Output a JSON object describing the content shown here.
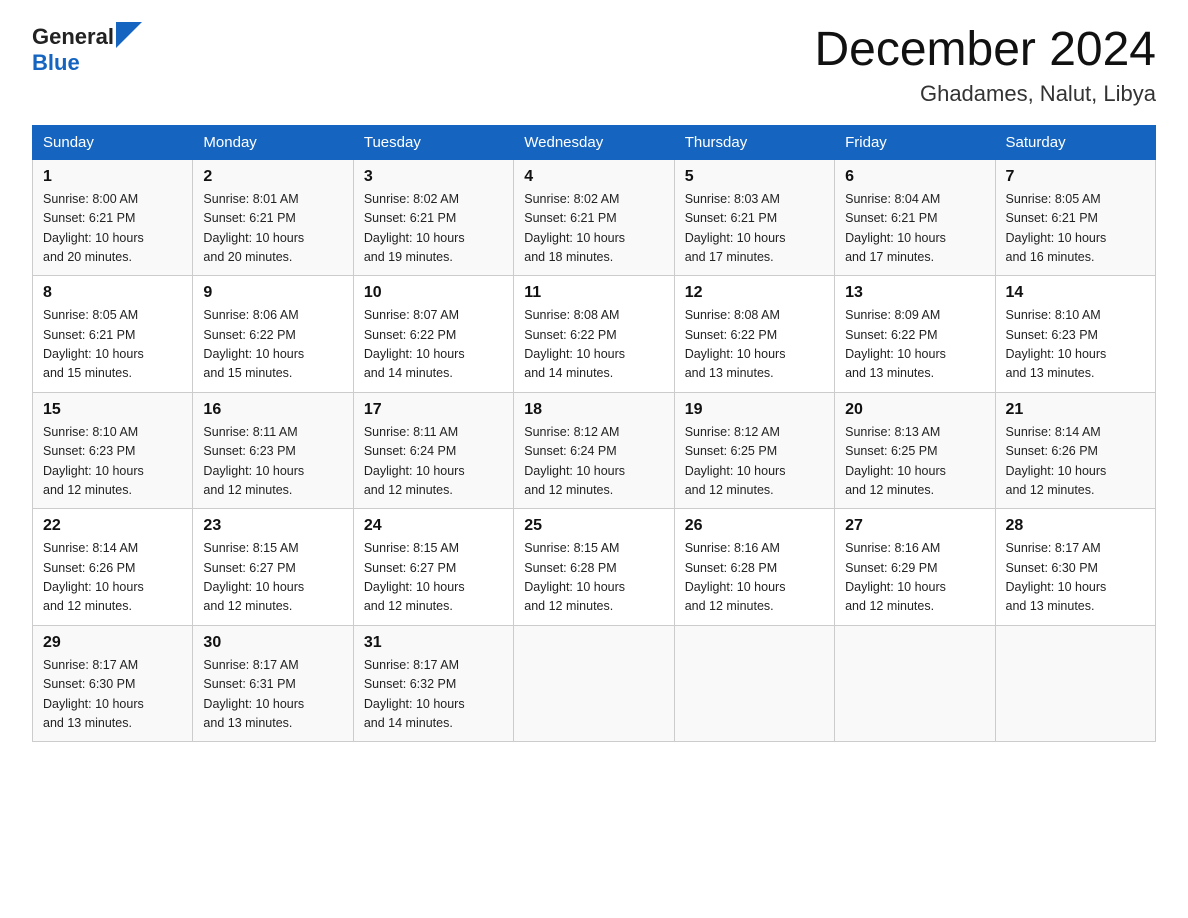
{
  "header": {
    "logo_general": "General",
    "logo_blue": "Blue",
    "month_title": "December 2024",
    "location": "Ghadames, Nalut, Libya"
  },
  "days_of_week": [
    "Sunday",
    "Monday",
    "Tuesday",
    "Wednesday",
    "Thursday",
    "Friday",
    "Saturday"
  ],
  "weeks": [
    [
      {
        "day": "1",
        "sunrise": "8:00 AM",
        "sunset": "6:21 PM",
        "daylight": "10 hours and 20 minutes."
      },
      {
        "day": "2",
        "sunrise": "8:01 AM",
        "sunset": "6:21 PM",
        "daylight": "10 hours and 20 minutes."
      },
      {
        "day": "3",
        "sunrise": "8:02 AM",
        "sunset": "6:21 PM",
        "daylight": "10 hours and 19 minutes."
      },
      {
        "day": "4",
        "sunrise": "8:02 AM",
        "sunset": "6:21 PM",
        "daylight": "10 hours and 18 minutes."
      },
      {
        "day": "5",
        "sunrise": "8:03 AM",
        "sunset": "6:21 PM",
        "daylight": "10 hours and 17 minutes."
      },
      {
        "day": "6",
        "sunrise": "8:04 AM",
        "sunset": "6:21 PM",
        "daylight": "10 hours and 17 minutes."
      },
      {
        "day": "7",
        "sunrise": "8:05 AM",
        "sunset": "6:21 PM",
        "daylight": "10 hours and 16 minutes."
      }
    ],
    [
      {
        "day": "8",
        "sunrise": "8:05 AM",
        "sunset": "6:21 PM",
        "daylight": "10 hours and 15 minutes."
      },
      {
        "day": "9",
        "sunrise": "8:06 AM",
        "sunset": "6:22 PM",
        "daylight": "10 hours and 15 minutes."
      },
      {
        "day": "10",
        "sunrise": "8:07 AM",
        "sunset": "6:22 PM",
        "daylight": "10 hours and 14 minutes."
      },
      {
        "day": "11",
        "sunrise": "8:08 AM",
        "sunset": "6:22 PM",
        "daylight": "10 hours and 14 minutes."
      },
      {
        "day": "12",
        "sunrise": "8:08 AM",
        "sunset": "6:22 PM",
        "daylight": "10 hours and 13 minutes."
      },
      {
        "day": "13",
        "sunrise": "8:09 AM",
        "sunset": "6:22 PM",
        "daylight": "10 hours and 13 minutes."
      },
      {
        "day": "14",
        "sunrise": "8:10 AM",
        "sunset": "6:23 PM",
        "daylight": "10 hours and 13 minutes."
      }
    ],
    [
      {
        "day": "15",
        "sunrise": "8:10 AM",
        "sunset": "6:23 PM",
        "daylight": "10 hours and 12 minutes."
      },
      {
        "day": "16",
        "sunrise": "8:11 AM",
        "sunset": "6:23 PM",
        "daylight": "10 hours and 12 minutes."
      },
      {
        "day": "17",
        "sunrise": "8:11 AM",
        "sunset": "6:24 PM",
        "daylight": "10 hours and 12 minutes."
      },
      {
        "day": "18",
        "sunrise": "8:12 AM",
        "sunset": "6:24 PM",
        "daylight": "10 hours and 12 minutes."
      },
      {
        "day": "19",
        "sunrise": "8:12 AM",
        "sunset": "6:25 PM",
        "daylight": "10 hours and 12 minutes."
      },
      {
        "day": "20",
        "sunrise": "8:13 AM",
        "sunset": "6:25 PM",
        "daylight": "10 hours and 12 minutes."
      },
      {
        "day": "21",
        "sunrise": "8:14 AM",
        "sunset": "6:26 PM",
        "daylight": "10 hours and 12 minutes."
      }
    ],
    [
      {
        "day": "22",
        "sunrise": "8:14 AM",
        "sunset": "6:26 PM",
        "daylight": "10 hours and 12 minutes."
      },
      {
        "day": "23",
        "sunrise": "8:15 AM",
        "sunset": "6:27 PM",
        "daylight": "10 hours and 12 minutes."
      },
      {
        "day": "24",
        "sunrise": "8:15 AM",
        "sunset": "6:27 PM",
        "daylight": "10 hours and 12 minutes."
      },
      {
        "day": "25",
        "sunrise": "8:15 AM",
        "sunset": "6:28 PM",
        "daylight": "10 hours and 12 minutes."
      },
      {
        "day": "26",
        "sunrise": "8:16 AM",
        "sunset": "6:28 PM",
        "daylight": "10 hours and 12 minutes."
      },
      {
        "day": "27",
        "sunrise": "8:16 AM",
        "sunset": "6:29 PM",
        "daylight": "10 hours and 12 minutes."
      },
      {
        "day": "28",
        "sunrise": "8:17 AM",
        "sunset": "6:30 PM",
        "daylight": "10 hours and 13 minutes."
      }
    ],
    [
      {
        "day": "29",
        "sunrise": "8:17 AM",
        "sunset": "6:30 PM",
        "daylight": "10 hours and 13 minutes."
      },
      {
        "day": "30",
        "sunrise": "8:17 AM",
        "sunset": "6:31 PM",
        "daylight": "10 hours and 13 minutes."
      },
      {
        "day": "31",
        "sunrise": "8:17 AM",
        "sunset": "6:32 PM",
        "daylight": "10 hours and 14 minutes."
      },
      null,
      null,
      null,
      null
    ]
  ],
  "labels": {
    "sunrise": "Sunrise:",
    "sunset": "Sunset:",
    "daylight": "Daylight:"
  }
}
